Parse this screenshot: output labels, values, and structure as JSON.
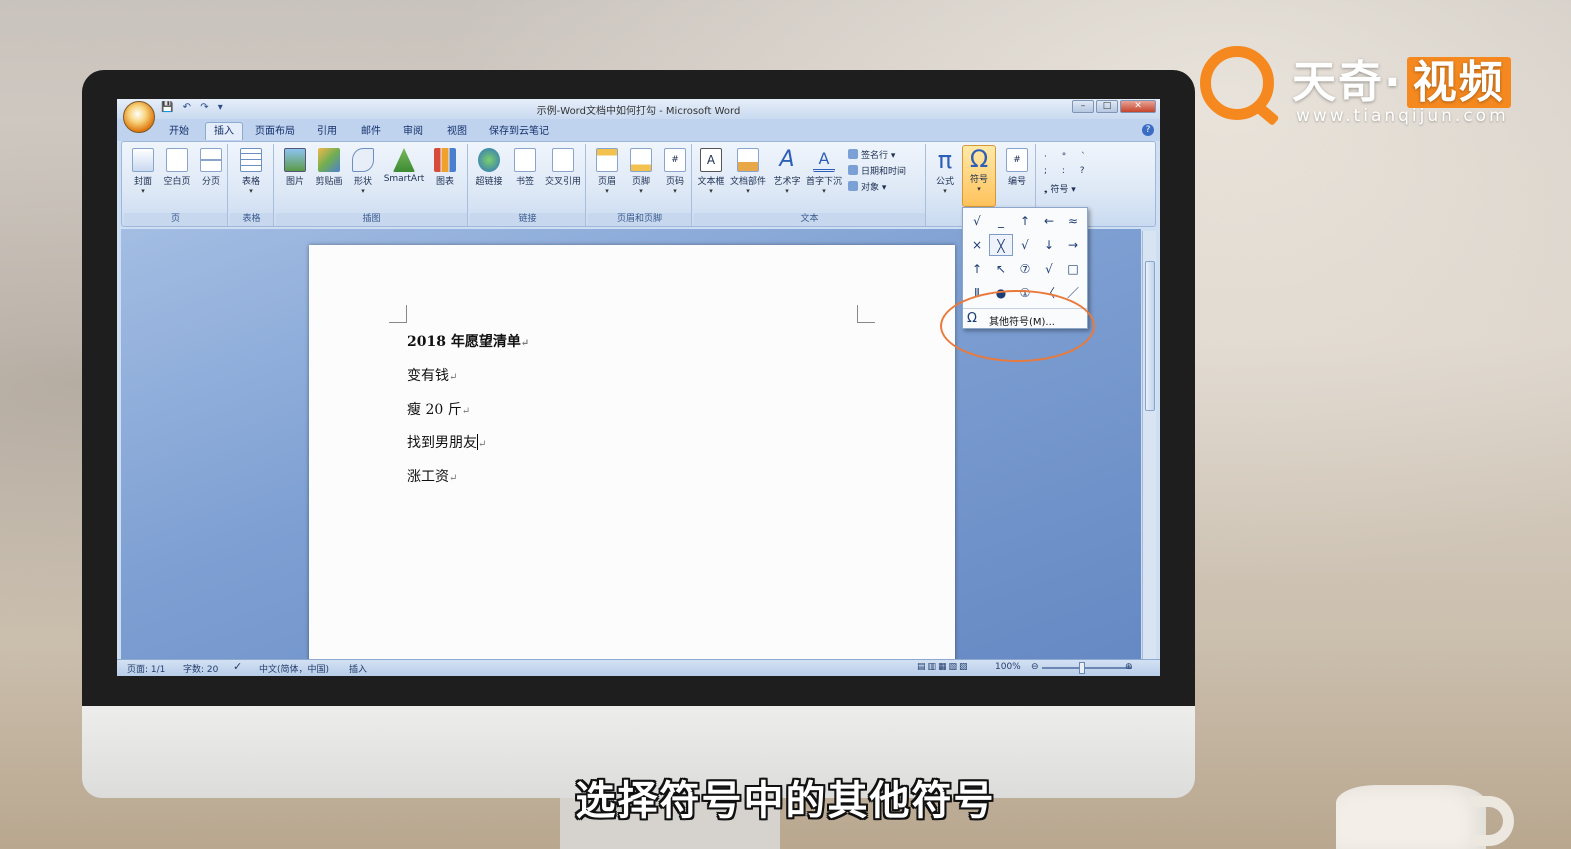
{
  "logo": {
    "name": "天奇",
    "name_box": "视频",
    "url": "www.tianqijun.com"
  },
  "subtitle": "选择符号中的其他符号",
  "window": {
    "title": "示例-Word文档中如何打勾 - Microsoft Word"
  },
  "tabs": [
    "开始",
    "插入",
    "页面布局",
    "引用",
    "邮件",
    "审阅",
    "视图",
    "保存到云笔记"
  ],
  "active_tab": "插入",
  "ribbon": {
    "groups": {
      "page": {
        "label": "页",
        "buttons": [
          "封面",
          "空白页",
          "分页"
        ]
      },
      "table": {
        "label": "表格",
        "buttons": [
          "表格"
        ]
      },
      "illustrations": {
        "label": "插图",
        "buttons": [
          "图片",
          "剪贴画",
          "形状",
          "SmartArt",
          "图表"
        ]
      },
      "links": {
        "label": "链接",
        "buttons": [
          "超链接",
          "书签",
          "交叉引用"
        ]
      },
      "header_footer": {
        "label": "页眉和页脚",
        "buttons": [
          "页眉",
          "页脚",
          "页码"
        ]
      },
      "text": {
        "label": "文本",
        "buttons": [
          "文本框",
          "文档部件",
          "艺术字",
          "首字下沉"
        ],
        "small": [
          "签名行",
          "日期和时间",
          "对象"
        ]
      },
      "symbols": {
        "buttons": [
          "公式",
          "符号",
          "编号"
        ],
        "small": "符号"
      }
    }
  },
  "symbol_popup": {
    "grid": [
      "√",
      "_",
      "↑",
      "←",
      "≈",
      "×",
      "╳",
      "√",
      "↓",
      "→",
      "↑",
      "↖",
      "⑦",
      "√",
      "□",
      "Ⅱ",
      "●",
      "①",
      "〈",
      "／"
    ],
    "more": "其他符号(M)..."
  },
  "document": {
    "lines": [
      "2018 年愿望清单",
      "变有钱",
      "瘦 20 斤",
      "找到男朋友",
      "涨工资"
    ],
    "pilcrow": "↵"
  },
  "status": {
    "page": "页面: 1/1",
    "words": "字数: 20",
    "lang": "中文(简体，中国)",
    "mode": "插入",
    "zoom": "100%"
  }
}
